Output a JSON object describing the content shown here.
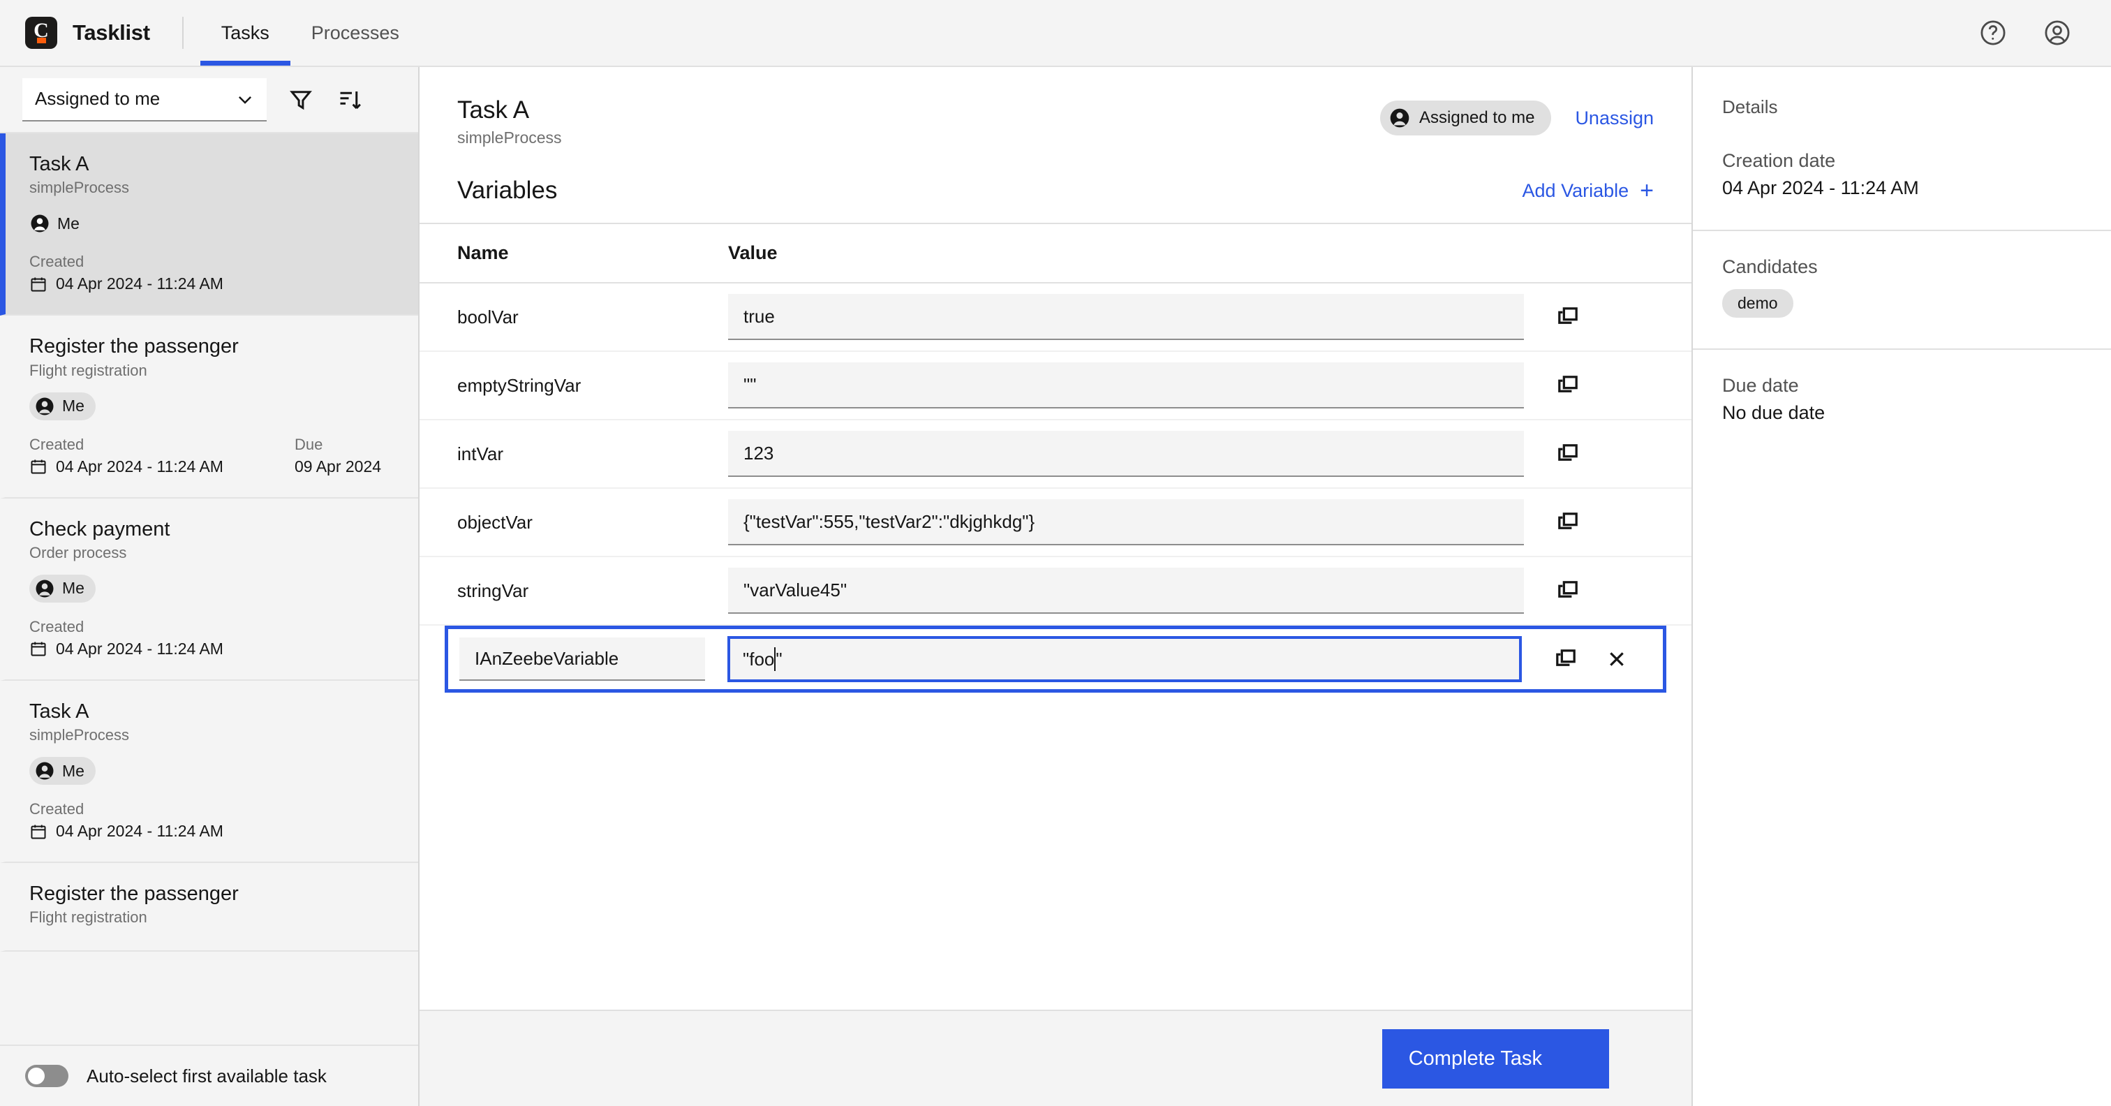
{
  "topbar": {
    "brand": "Tasklist",
    "logo_glyph": "C",
    "nav": [
      {
        "label": "Tasks",
        "active": true
      },
      {
        "label": "Processes",
        "active": false
      }
    ],
    "help_icon": "help-circle-icon",
    "account_icon": "user-avatar-icon"
  },
  "sidebar": {
    "filter": {
      "selected": "Assigned to me",
      "chevron_icon": "chevron-down-icon",
      "filter_icon": "funnel-filter-icon",
      "sort_icon": "sort-descending-icon"
    },
    "tasks": [
      {
        "title": "Task A",
        "process": "simpleProcess",
        "assignee": "Me",
        "created_label": "Created",
        "created_value": "04 Apr 2024 - 11:24 AM",
        "due_label": "",
        "due_value": "",
        "selected": true
      },
      {
        "title": "Register the passenger",
        "process": "Flight registration",
        "assignee": "Me",
        "created_label": "Created",
        "created_value": "04 Apr 2024 - 11:24 AM",
        "due_label": "Due",
        "due_value": "09 Apr 2024",
        "selected": false
      },
      {
        "title": "Check payment",
        "process": "Order process",
        "assignee": "Me",
        "created_label": "Created",
        "created_value": "04 Apr 2024 - 11:24 AM",
        "due_label": "",
        "due_value": "",
        "selected": false
      },
      {
        "title": "Task A",
        "process": "simpleProcess",
        "assignee": "Me",
        "created_label": "Created",
        "created_value": "04 Apr 2024 - 11:24 AM",
        "due_label": "",
        "due_value": "",
        "selected": false
      },
      {
        "title": "Register the passenger",
        "process": "Flight registration",
        "assignee": "",
        "created_label": "",
        "created_value": "",
        "due_label": "",
        "due_value": "",
        "selected": false
      }
    ],
    "autoselect": {
      "label": "Auto-select first available task",
      "enabled": false
    }
  },
  "main": {
    "task_title": "Task A",
    "task_process": "simpleProcess",
    "assigned_pill": "Assigned to me",
    "unassign_label": "Unassign",
    "variables_title": "Variables",
    "add_variable_label": "Add Variable",
    "add_variable_plus": "+",
    "columns": {
      "name": "Name",
      "value": "Value"
    },
    "variables": [
      {
        "name": "boolVar",
        "value": "true"
      },
      {
        "name": "emptyStringVar",
        "value": "\"\""
      },
      {
        "name": "intVar",
        "value": "123"
      },
      {
        "name": "objectVar",
        "value": "{\"testVar\":555,\"testVar2\":\"dkjghkdg\"}"
      },
      {
        "name": "stringVar",
        "value": "\"varValue45\""
      }
    ],
    "new_variable": {
      "name": "IAnZeebeVariable",
      "value_before_caret": "\"foo",
      "value_after_caret": "\"",
      "copy_icon": "copy-icon",
      "remove_icon": "close-x-icon"
    },
    "complete_button": "Complete Task"
  },
  "details": {
    "heading": "Details",
    "creation_date_label": "Creation date",
    "creation_date_value": "04 Apr 2024 - 11:24 AM",
    "candidates_label": "Candidates",
    "candidates": [
      "demo"
    ],
    "due_date_label": "Due date",
    "due_date_value": "No due date"
  },
  "colors": {
    "accent_blue": "#2b57e3",
    "brand_orange": "#fc5d0d",
    "surface_grey": "#f4f4f4",
    "selected_grey": "#dedede"
  }
}
